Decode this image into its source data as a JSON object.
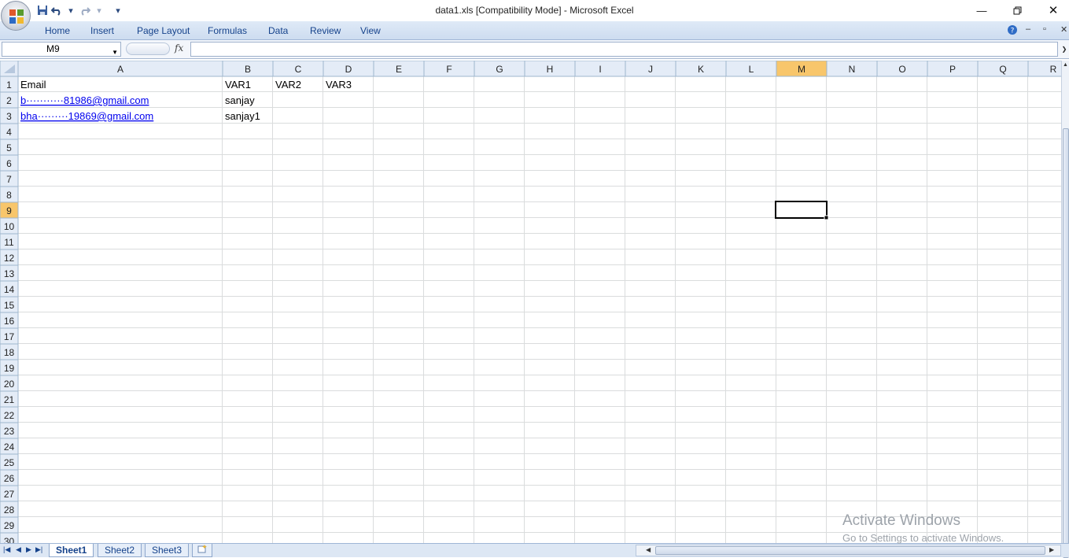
{
  "window": {
    "title": "data1.xls  [Compatibility Mode] - Microsoft Excel"
  },
  "ribbon": {
    "tabs": [
      "Home",
      "Insert",
      "Page Layout",
      "Formulas",
      "Data",
      "Review",
      "View"
    ]
  },
  "formula_bar": {
    "name_box": "M9",
    "fx_label": "fx",
    "formula": ""
  },
  "sheet": {
    "columns": [
      "A",
      "B",
      "C",
      "D",
      "E",
      "F",
      "G",
      "H",
      "I",
      "J",
      "K",
      "L",
      "M",
      "N",
      "O",
      "P",
      "Q",
      "R"
    ],
    "row_count": 30,
    "selected_cell": "M9",
    "cells": {
      "A1": "Email",
      "B1": "VAR1",
      "C1": "VAR2",
      "D1": "VAR3",
      "A2": "b···········81986@gmail.com",
      "B2": "sanjay",
      "A3": "bha·········19869@gmail.com",
      "B3": "sanjay1"
    },
    "link_cells": [
      "A2",
      "A3"
    ]
  },
  "sheet_tabs": [
    "Sheet1",
    "Sheet2",
    "Sheet3"
  ],
  "active_sheet": "Sheet1",
  "watermark": {
    "line1": "Activate Windows",
    "line2": "Go to Settings to activate Windows."
  },
  "colors": {
    "header_bg": "#e4ecf7",
    "selected_header": "#f8c66b",
    "gridline": "#dadcdd",
    "link": "#0000ee",
    "ribbon_text": "#15428b"
  }
}
